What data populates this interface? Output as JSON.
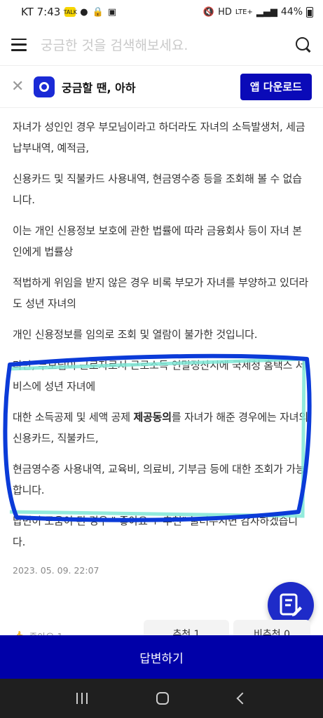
{
  "status_bar": {
    "carrier_time": "KT 7:43",
    "network": "LTE+",
    "battery": "44%"
  },
  "search": {
    "placeholder": "궁금한 것을 검색해보세요."
  },
  "banner": {
    "text": "궁금할 땐, 아하",
    "download_label": "앱 다운로드"
  },
  "answer": {
    "paragraphs": [
      "자녀가 성인인 경우 부모님이라고 하더라도 자녀의 소득발생처, 세금 납부내역, 예적금,",
      "신용카드 및 직불카드 사용내역, 현금영수증 등을 조회해 볼 수 없습니다.",
      "이는 개인 신용정보 보호에 관한 법률에 따라 금융회사 등이 자녀 본인에게 법률상",
      "적법하게 위임을 받지 않은 경우 비록 부모가 자녀를 부양하고 있더라도 성년 자녀의",
      "개인 신용정보를 임의로 조회 및 열람이 불가한 것입니다.",
      "다만, 부모님이 근로자로서 근로소득 연말정산시에 국세청 홈택스 서비스에 성년 자녀에"
    ],
    "p7_before": "대한 소득공제 및 세액 공제 ",
    "p7_bold": "제공동의",
    "p7_after": "를 자녀가 해준 경우에는 자녀의 신용카드, 직불카드,",
    "p8": "현금영수증 사용내역, 교육비, 의료비, 기부금 등에 대한 조회가 가능합니다.",
    "p9": "답변이 도움이 된 경우 \" 좋아요 + 추천\" 눌러주시면 감사하겠습니다.",
    "date": "2023. 05. 09. 22:07"
  },
  "actions": {
    "like": "좋아요 1",
    "recommend": "추천 1",
    "not_recommend": "비추천 0"
  },
  "answer_button": "답변하기",
  "icons": {
    "menu": "menu-icon",
    "search": "search-icon",
    "close": "close-icon",
    "write": "edit-note-icon",
    "thumb": "thumbs-up-icon"
  },
  "colors": {
    "primary": "#0000a8",
    "highlight_pen": "#0b3bd8"
  }
}
